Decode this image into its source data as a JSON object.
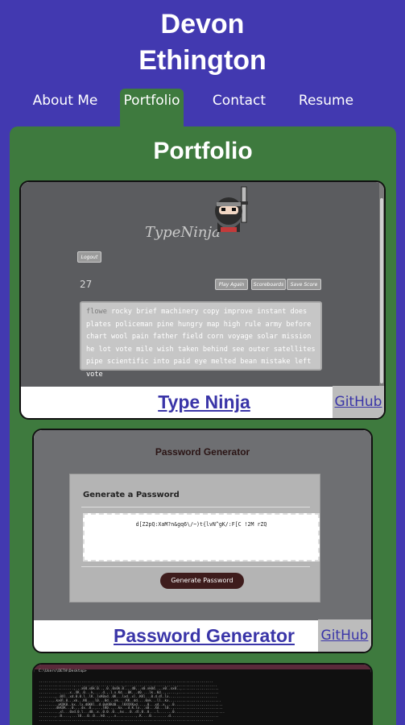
{
  "header": {
    "name_line1": "Devon",
    "name_line2": "Ethington"
  },
  "nav": {
    "items": [
      {
        "label": "About Me"
      },
      {
        "label": "Portfolio",
        "active": true
      },
      {
        "label": "Contact"
      },
      {
        "label": "Resume"
      }
    ]
  },
  "portfolio": {
    "title": "Portfolio",
    "projects": [
      {
        "name": "Type Ninja",
        "github_label": "GitHub",
        "preview": {
          "logo": "TypeNinja",
          "logout": "Logout",
          "count": "27",
          "buttons": [
            "Play Again",
            "Scoreboards",
            "Save Score"
          ],
          "typed": "flowe",
          "text": "rocky brief machinery copy improve instant does plates policeman pine hungry map high rule army before chart wool pain father field corn voyage solar mission he lot vote mile wish taken behind see outer satellites pipe scientific into paid eye melted bean mistake left vote"
        }
      },
      {
        "name": "Password Generator",
        "github_label": "GitHub",
        "preview": {
          "title": "Password Generator",
          "heading": "Generate a Password",
          "password": "d[Z2pQ:XaM?n&gq6\\/~)t{lvN^gK/:F[C !2M rZQ",
          "button": "Generate Password"
        }
      },
      {
        "name": "",
        "preview": {
          "path": "C:\\Users\\DETH\\Desktop>"
        }
      }
    ]
  },
  "colors": {
    "background": "#4239b0",
    "panel": "#3e7a3e",
    "link": "#3a35a8"
  },
  "icons": {
    "ninja": "ninja-avatar-icon"
  }
}
